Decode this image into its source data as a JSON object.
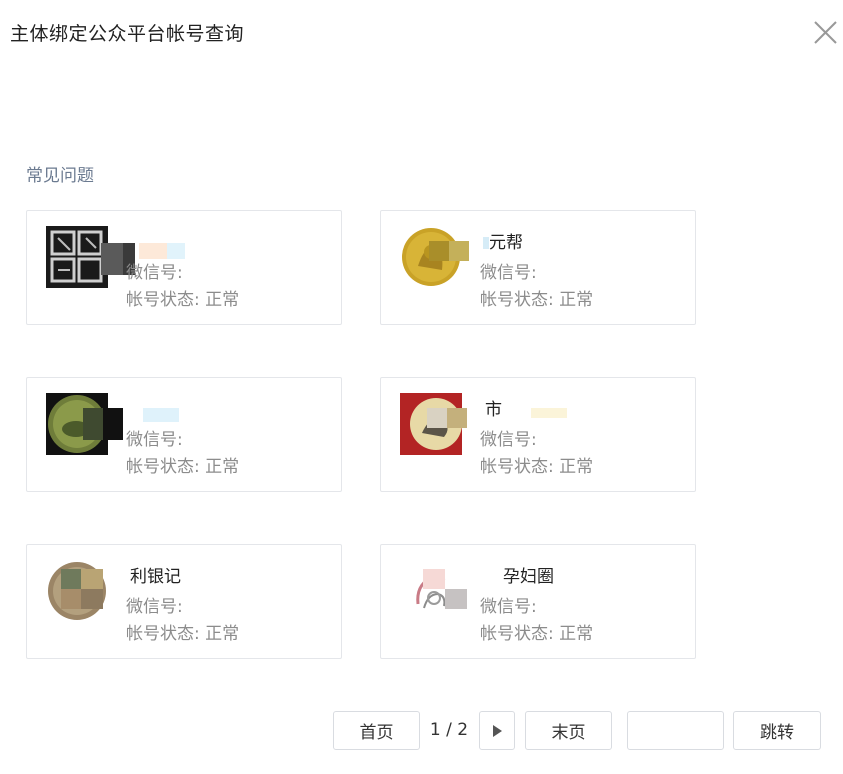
{
  "dialog": {
    "title": "主体绑定公众平台帐号查询"
  },
  "section": {
    "label": "常见问题"
  },
  "labels": {
    "wechat_prefix": "微信号:",
    "status_prefix": "帐号状态: 正常"
  },
  "accounts": [
    {
      "name": "",
      "wechat": "微信号:",
      "status": "帐号状态: 正常",
      "avatar": "seal-stamp-avatar"
    },
    {
      "name": "元帮",
      "wechat": "微信号:",
      "status": "帐号状态: 正常",
      "avatar": "gold-coin-avatar"
    },
    {
      "name": "",
      "wechat": "微信号:",
      "status": "帐号状态: 正常",
      "avatar": "green-coin-avatar"
    },
    {
      "name": "市",
      "wechat": "微信号:",
      "status": "帐号状态: 正常",
      "avatar": "red-coin-avatar"
    },
    {
      "name": "利银记",
      "wechat": "微信号:",
      "status": "帐号状态: 正常",
      "avatar": "bronze-coin-avatar"
    },
    {
      "name": "孕妇圈",
      "wechat": "微信号:",
      "status": "帐号状态: 正常",
      "avatar": "mother-baby-avatar"
    }
  ],
  "pagination": {
    "first_label": "首页",
    "page_info": "1 / 2",
    "last_label": "末页",
    "jump_label": "跳转",
    "jump_input_value": ""
  }
}
